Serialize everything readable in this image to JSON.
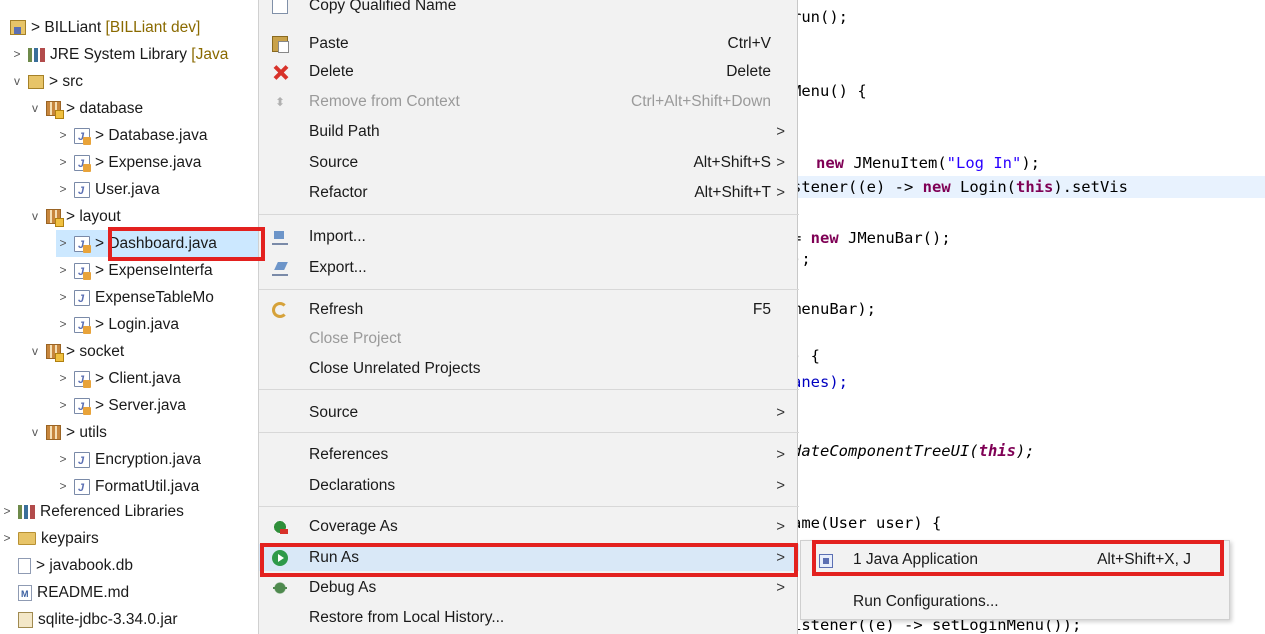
{
  "colors": {
    "callout": "#e3211f",
    "menu_bg": "#f2f2f2",
    "keyword": "#7f0055",
    "string": "#2a00ff",
    "selection": "#cce8ff"
  },
  "tree": {
    "items": [
      {
        "label": "> BILLiant",
        "decoration": "[BILLiant dev]",
        "icon": "project-icon",
        "twisty": ""
      },
      {
        "label": "JRE System Library",
        "decoration": "[Java",
        "icon": "library-icon",
        "twisty": ">"
      },
      {
        "label": "> src",
        "decoration": "",
        "icon": "source-folder-icon",
        "twisty": "v"
      },
      {
        "label": "> database",
        "decoration": "",
        "icon": "package-icon",
        "twisty": "v"
      },
      {
        "label": "> Database.java",
        "decoration": "",
        "icon": "java-file-icon",
        "twisty": ">"
      },
      {
        "label": "> Expense.java",
        "decoration": "",
        "icon": "java-file-icon",
        "twisty": ">"
      },
      {
        "label": "User.java",
        "decoration": "",
        "icon": "java-file-icon",
        "twisty": ">"
      },
      {
        "label": "> layout",
        "decoration": "",
        "icon": "package-icon",
        "twisty": "v"
      },
      {
        "label": "> Dashboard.java",
        "decoration": "",
        "icon": "java-file-icon",
        "twisty": ">"
      },
      {
        "label": "> ExpenseInterfa",
        "decoration": "",
        "icon": "java-file-icon",
        "twisty": ">"
      },
      {
        "label": "ExpenseTableMo",
        "decoration": "",
        "icon": "java-file-icon",
        "twisty": ">"
      },
      {
        "label": "> Login.java",
        "decoration": "",
        "icon": "java-file-icon",
        "twisty": ">"
      },
      {
        "label": "> socket",
        "decoration": "",
        "icon": "package-icon",
        "twisty": "v"
      },
      {
        "label": "> Client.java",
        "decoration": "",
        "icon": "java-file-icon",
        "twisty": ">"
      },
      {
        "label": "> Server.java",
        "decoration": "",
        "icon": "java-file-icon",
        "twisty": ">"
      },
      {
        "label": "> utils",
        "decoration": "",
        "icon": "package-icon",
        "twisty": "v"
      },
      {
        "label": "Encryption.java",
        "decoration": "",
        "icon": "java-file-icon",
        "twisty": ">"
      },
      {
        "label": "FormatUtil.java",
        "decoration": "",
        "icon": "java-file-icon",
        "twisty": ">"
      },
      {
        "label": "Referenced Libraries",
        "decoration": "",
        "icon": "library-icon",
        "twisty": ">"
      },
      {
        "label": "keypairs",
        "decoration": "",
        "icon": "folder-icon",
        "twisty": ">"
      },
      {
        "label": "> javabook.db",
        "decoration": "",
        "icon": "file-icon",
        "twisty": ""
      },
      {
        "label": "README.md",
        "decoration": "",
        "icon": "markdown-icon",
        "twisty": ""
      },
      {
        "label": "sqlite-jdbc-3.34.0.jar",
        "decoration": "",
        "icon": "jar-icon",
        "twisty": ""
      }
    ]
  },
  "menu": {
    "items": [
      {
        "label": "Copy Qualified Name",
        "accel": "",
        "submenu": false,
        "disabled": false,
        "icon": "copy-qualified-icon"
      },
      {
        "label": "Paste",
        "accel": "Ctrl+V",
        "submenu": false,
        "disabled": false,
        "icon": "paste-icon"
      },
      {
        "label": "Delete",
        "accel": "Delete",
        "submenu": false,
        "disabled": false,
        "icon": "delete-icon"
      },
      {
        "label": "Remove from Context",
        "accel": "Ctrl+Alt+Shift+Down",
        "submenu": false,
        "disabled": true,
        "icon": "remove-context-icon"
      },
      {
        "label": "Build Path",
        "accel": "",
        "submenu": true,
        "disabled": false,
        "icon": ""
      },
      {
        "label": "Source",
        "accel": "Alt+Shift+S",
        "submenu": true,
        "disabled": false,
        "icon": ""
      },
      {
        "label": "Refactor",
        "accel": "Alt+Shift+T",
        "submenu": true,
        "disabled": false,
        "icon": ""
      },
      {
        "label": "Import...",
        "accel": "",
        "submenu": false,
        "disabled": false,
        "icon": "import-icon"
      },
      {
        "label": "Export...",
        "accel": "",
        "submenu": false,
        "disabled": false,
        "icon": "export-icon"
      },
      {
        "label": "Refresh",
        "accel": "F5",
        "submenu": false,
        "disabled": false,
        "icon": "refresh-icon"
      },
      {
        "label": "Close Project",
        "accel": "",
        "submenu": false,
        "disabled": true,
        "icon": ""
      },
      {
        "label": "Close Unrelated Projects",
        "accel": "",
        "submenu": false,
        "disabled": false,
        "icon": ""
      },
      {
        "label": "Source",
        "accel": "",
        "submenu": true,
        "disabled": false,
        "icon": ""
      },
      {
        "label": "References",
        "accel": "",
        "submenu": true,
        "disabled": false,
        "icon": ""
      },
      {
        "label": "Declarations",
        "accel": "",
        "submenu": true,
        "disabled": false,
        "icon": ""
      },
      {
        "label": "Coverage As",
        "accel": "",
        "submenu": true,
        "disabled": false,
        "icon": "coverage-icon"
      },
      {
        "label": "Run As",
        "accel": "",
        "submenu": true,
        "disabled": false,
        "icon": "run-icon"
      },
      {
        "label": "Debug As",
        "accel": "",
        "submenu": true,
        "disabled": false,
        "icon": "debug-icon"
      },
      {
        "label": "Restore from Local History...",
        "accel": "",
        "submenu": false,
        "disabled": false,
        "icon": ""
      }
    ],
    "submenu_arrow": ">"
  },
  "run_as_submenu": {
    "items": [
      {
        "label": "1 Java Application",
        "accel": "Alt+Shift+X, J",
        "icon": "java-application-icon"
      },
      {
        "label": "Run Configurations...",
        "accel": "",
        "icon": ""
      }
    ]
  },
  "code": {
    "lines": [
      "run();",
      "Menu() {",
      "new JMenuItem(\"Log In\");",
      "stener((e) -> new Login(this).setVis",
      "= new JMenuBar();",
      ");",
      "menuBar);",
      ") {",
      "anes);",
      "dateComponentTreeUI(this);",
      "ame(User user) {",
      "istener((e) -> setLoginMenu());"
    ]
  }
}
